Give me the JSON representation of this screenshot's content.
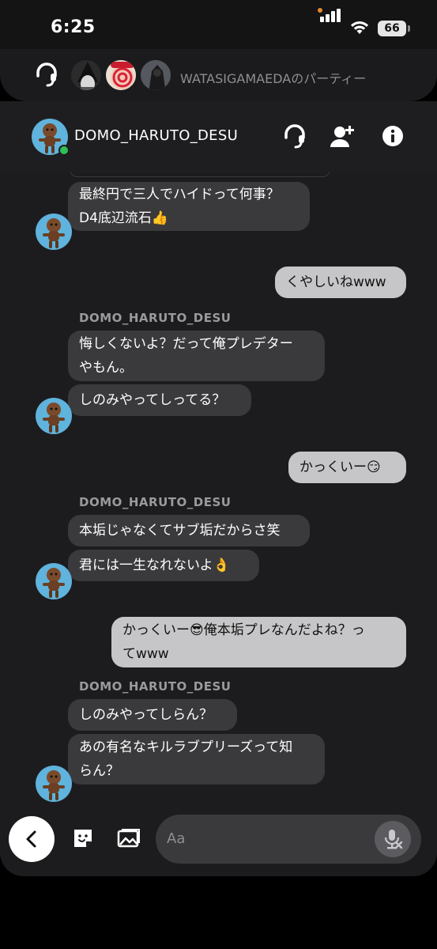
{
  "status": {
    "time": "6:25",
    "battery": "66"
  },
  "party": {
    "name": "WATASIGAMAEDAのパーティー"
  },
  "header": {
    "title": "DOMO_HARUTO_DESU"
  },
  "messages": [
    {
      "side": "in",
      "text": "最終円で三人でハイドって何事？"
    },
    {
      "side": "in",
      "text": "D4底辺流石👍"
    },
    {
      "side": "out",
      "text": "くやしいねwww"
    },
    {
      "side": "in",
      "sender": "DOMO_HARUTO_DESU",
      "text": "悔しくないよ？だって俺プレデター"
    },
    {
      "side": "in",
      "text": "やもん。"
    },
    {
      "side": "in",
      "text": "しのみやってしってる？"
    },
    {
      "side": "out",
      "text": "かっくいー😏"
    },
    {
      "side": "in",
      "sender": "DOMO_HARUTO_DESU",
      "text": "本垢じゃなくてサブ垢だからさ笑"
    },
    {
      "side": "in",
      "text": "君には一生なれないよ👌"
    },
    {
      "side": "out",
      "text": "かっくいー😎俺本垢プレなんだよね？っ"
    },
    {
      "side": "out",
      "text": "てwww"
    },
    {
      "side": "in",
      "sender": "DOMO_HARUTO_DESU",
      "text": "しのみやってしらん？"
    },
    {
      "side": "in",
      "text": "あの有名なキルラブプリーズって知"
    },
    {
      "side": "in",
      "text": "らん？"
    }
  ],
  "composer": {
    "placeholder": "Aa"
  },
  "icons": {
    "headset": "headset-icon",
    "add_friend": "add-friend-icon",
    "info": "info-icon",
    "back": "chevron-left-icon",
    "sticker": "sticker-icon",
    "image": "image-icon",
    "mic_off": "mic-off-icon"
  },
  "colors": {
    "online": "#2ec15a",
    "incoming_bubble": "#3a3a3c",
    "outgoing_bubble": "#c6c6c8",
    "background": "#1c1c1e"
  }
}
